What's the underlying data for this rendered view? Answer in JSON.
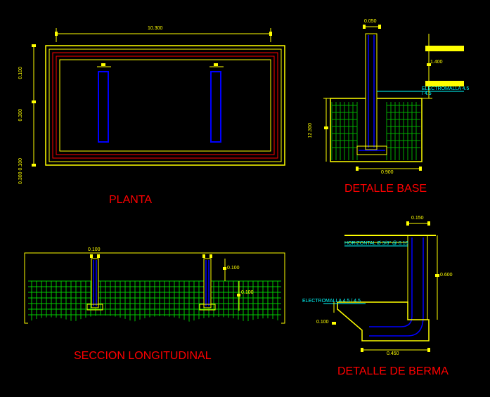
{
  "planta": {
    "title": "PLANTA",
    "dim_top": "10.300",
    "dim_left_top": "0.100",
    "dim_left_mid": "0.300",
    "dim_left_lower": "0.300 0.100"
  },
  "detalle_base": {
    "title": "DETALLE BASE",
    "label_electromalla": "ELECTROMALLA 4.5 / 4.5",
    "dim_top": "0.050",
    "dim_right": "1.400",
    "dim_left": "12.300",
    "dim_bottom": "0.900"
  },
  "seccion": {
    "title": "SECCION LONGITUDINAL",
    "dim_1": "0.100",
    "dim_2": "0.100",
    "dim_3": "0.100"
  },
  "detalle_berma": {
    "title": "DETALLE DE BERMA",
    "label_horizontal": "HORIZONTAL Ø 3/8\" @ 0.10",
    "label_electromalla": "ELECTROMALLA 4.5 / 4.5",
    "dim_top": "0.150",
    "dim_right": "0.600",
    "dim_left": "0.100",
    "dim_bottom": "0.450"
  }
}
